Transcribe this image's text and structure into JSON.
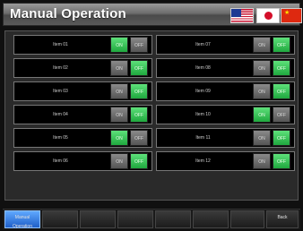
{
  "window": {
    "title": "Manual Operation",
    "languages": [
      {
        "name": "English",
        "icon": "us-flag-icon"
      },
      {
        "name": "Japanese",
        "icon": "japan-flag-icon"
      },
      {
        "name": "Chinese",
        "icon": "china-flag-icon"
      }
    ]
  },
  "colors": {
    "active": "#3ccc5c",
    "inactive": "#707070",
    "nav_active": "#3a86e8"
  },
  "items": {
    "left": [
      {
        "label": "Item 01",
        "on_label": "ON",
        "off_label": "OFF",
        "state": "on"
      },
      {
        "label": "Item 02",
        "on_label": "ON",
        "off_label": "OFF",
        "state": "off"
      },
      {
        "label": "Item 03",
        "on_label": "ON",
        "off_label": "OFF",
        "state": "off"
      },
      {
        "label": "Item 04",
        "on_label": "ON",
        "off_label": "OFF",
        "state": "off"
      },
      {
        "label": "Item 05",
        "on_label": "ON",
        "off_label": "OFF",
        "state": "on"
      },
      {
        "label": "Item 06",
        "on_label": "ON",
        "off_label": "OFF",
        "state": "off"
      }
    ],
    "right": [
      {
        "label": "Item 07",
        "on_label": "ON",
        "off_label": "OFF",
        "state": "off"
      },
      {
        "label": "Item 08",
        "on_label": "ON",
        "off_label": "OFF",
        "state": "off"
      },
      {
        "label": "Item 09",
        "on_label": "ON",
        "off_label": "OFF",
        "state": "off"
      },
      {
        "label": "Item 10",
        "on_label": "ON",
        "off_label": "OFF",
        "state": "on"
      },
      {
        "label": "Item 11",
        "on_label": "ON",
        "off_label": "OFF",
        "state": "off"
      },
      {
        "label": "Item 12",
        "on_label": "ON",
        "off_label": "OFF",
        "state": "off"
      }
    ]
  },
  "bottom_nav": {
    "active_label_line1": "Manual",
    "active_label_line2": "Operation",
    "back_label": "Back"
  }
}
